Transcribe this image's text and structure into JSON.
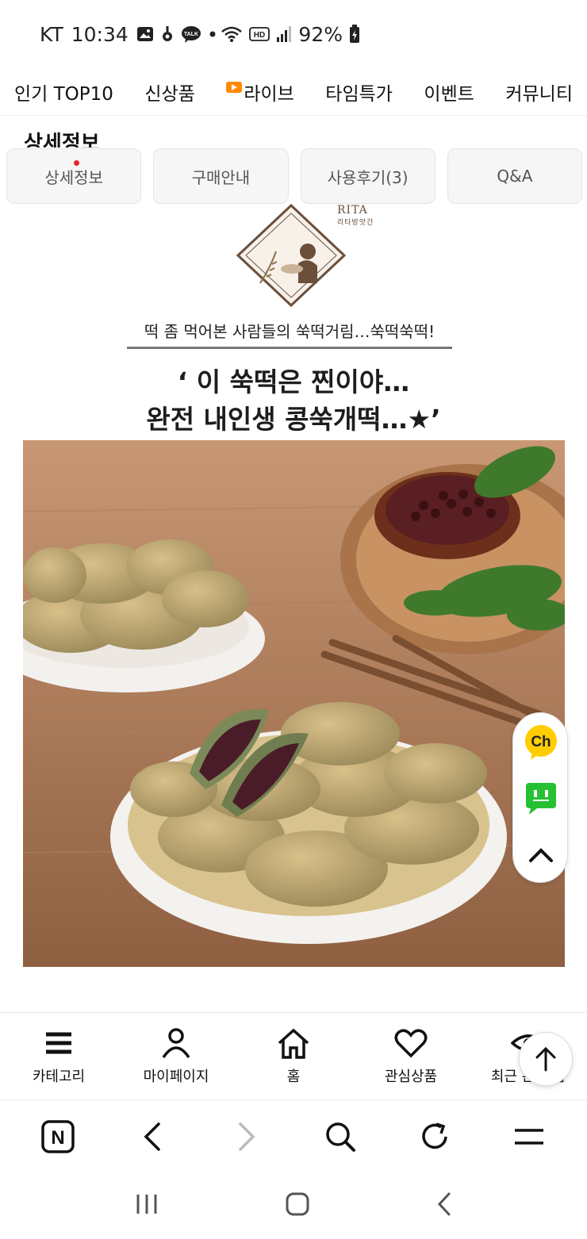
{
  "status_bar": {
    "carrier": "KT",
    "time": "10:34",
    "talk_label": "TALK",
    "hd_label": "HD",
    "battery": "92%"
  },
  "top_nav": {
    "items": [
      "인기 TOP10",
      "신상품",
      "라이브",
      "타임특가",
      "이벤트",
      "커뮤니티"
    ]
  },
  "section_title": "상세정보",
  "tabs": [
    "상세정보",
    "구매안내",
    "사용후기(3)",
    "Q&A"
  ],
  "product": {
    "brand": "RITA",
    "brand_korean": "리타방앗간",
    "tagline": "떡 좀 먹어본 사람들의 쑥떡거림…쑥떡쑥떡!",
    "headline_line1": "‘ 이 쑥떡은 찐이야…",
    "headline_line2": "완전 내인생 콩쑥개떡…★’"
  },
  "float_panel": {
    "channel_label": "Ch"
  },
  "app_nav": {
    "items": [
      "카테고리",
      "마이페이지",
      "홈",
      "관심상품",
      "최근 본 상품"
    ]
  },
  "browser_bar": {
    "icons": [
      "naver-icon",
      "back-icon",
      "forward-icon",
      "search-icon",
      "refresh-icon",
      "menu-icon"
    ],
    "naver_letter": "N"
  },
  "colors": {
    "live_badge": "#ff8a00",
    "kakao_yellow": "#ffcd00",
    "talk_green": "#25c132",
    "notice_dot": "#e8242c",
    "brand_brown": "#6b4f3b"
  }
}
